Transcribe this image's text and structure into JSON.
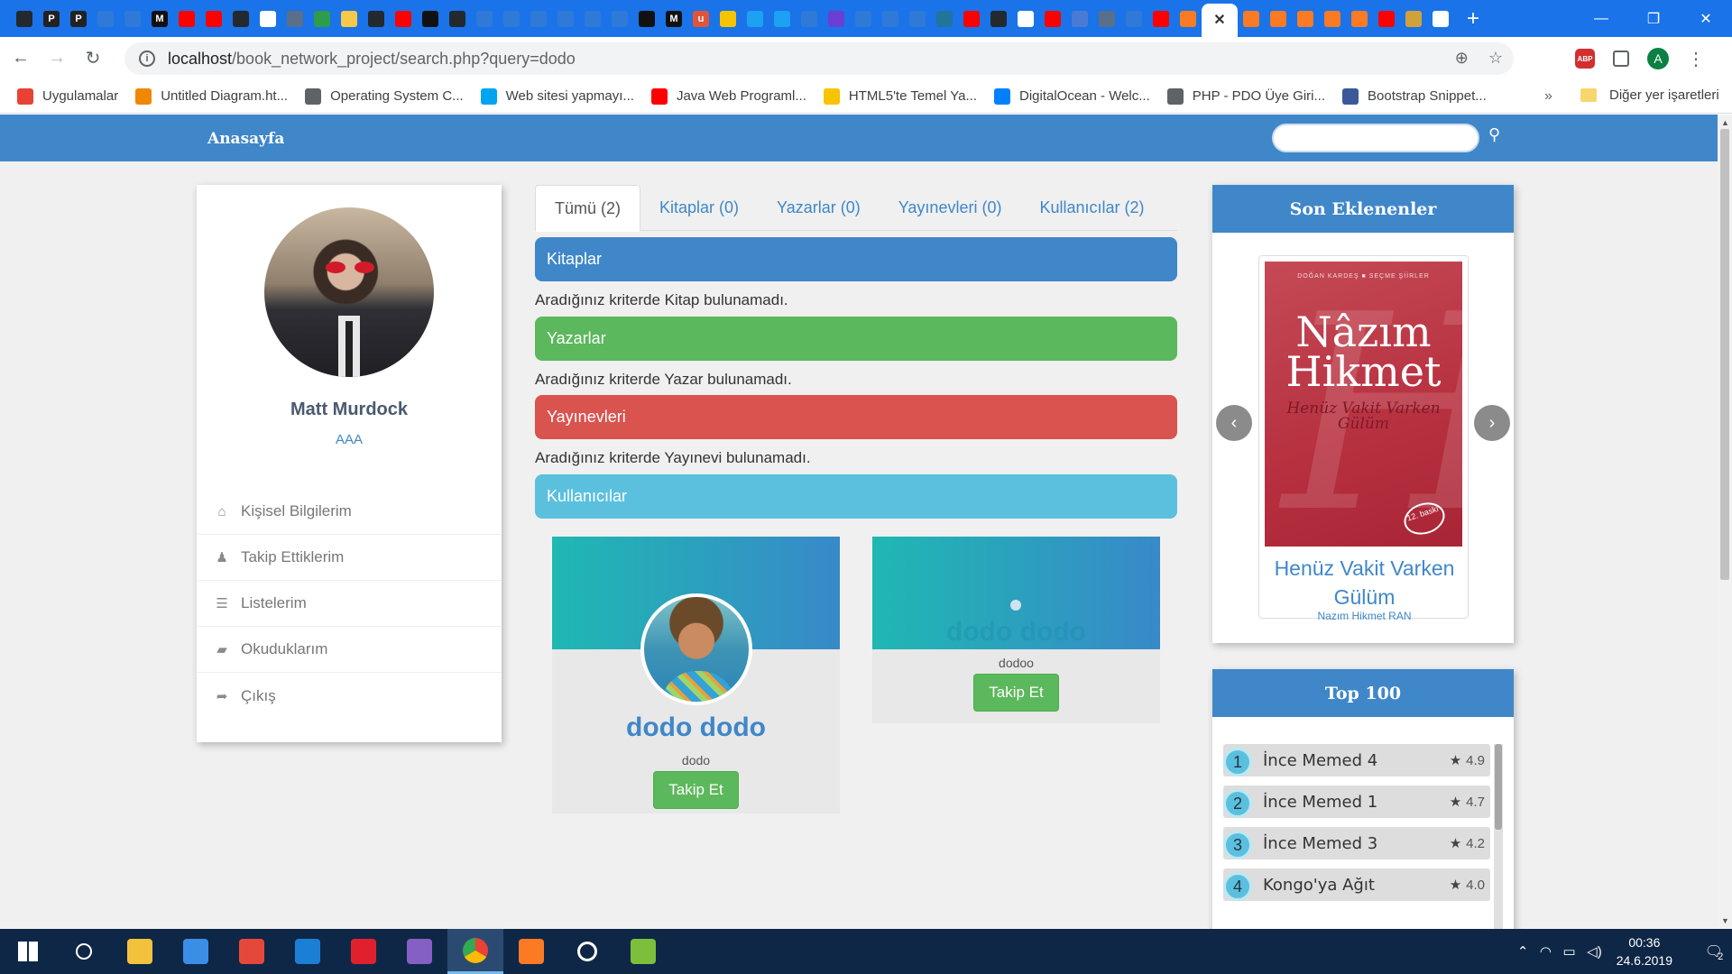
{
  "browser": {
    "tab_favicons": [
      {
        "name": "github",
        "glyph": "",
        "color": "#24292e"
      },
      {
        "name": "p-bookmark",
        "glyph": "P",
        "color": "#222222"
      },
      {
        "name": "p-bookmark-2",
        "glyph": "P",
        "color": "#222222"
      },
      {
        "name": "tab",
        "glyph": "",
        "color": "#2f7ad8"
      },
      {
        "name": "tab",
        "glyph": "",
        "color": "#2f7ad8"
      },
      {
        "name": "medium",
        "glyph": "M",
        "color": "#111111"
      },
      {
        "name": "youtube",
        "glyph": "",
        "color": "#ff0000"
      },
      {
        "name": "youtube",
        "glyph": "",
        "color": "#ff0000"
      },
      {
        "name": "github",
        "glyph": "",
        "color": "#24292e"
      },
      {
        "name": "tab",
        "glyph": "",
        "color": "#ffffff"
      },
      {
        "name": "tab",
        "glyph": "",
        "color": "#5a6f8a"
      },
      {
        "name": "tab",
        "glyph": "",
        "color": "#2e9c4a"
      },
      {
        "name": "python",
        "glyph": "",
        "color": "#f7c948"
      },
      {
        "name": "github",
        "glyph": "",
        "color": "#24292e"
      },
      {
        "name": "youtube",
        "glyph": "",
        "color": "#ff0000"
      },
      {
        "name": "tab",
        "glyph": "",
        "color": "#111111"
      },
      {
        "name": "github",
        "glyph": "",
        "color": "#24292e"
      },
      {
        "name": "tab",
        "glyph": "",
        "color": "#2f7ad8"
      },
      {
        "name": "tab",
        "glyph": "",
        "color": "#2f7ad8"
      },
      {
        "name": "tab",
        "glyph": "",
        "color": "#2f7ad8"
      },
      {
        "name": "tab",
        "glyph": "",
        "color": "#2f7ad8"
      },
      {
        "name": "tab",
        "glyph": "",
        "color": "#2f7ad8"
      },
      {
        "name": "tab",
        "glyph": "",
        "color": "#2f7ad8"
      },
      {
        "name": "tab",
        "glyph": "",
        "color": "#111111"
      },
      {
        "name": "medium",
        "glyph": "M",
        "color": "#111111"
      },
      {
        "name": "tab",
        "glyph": "u",
        "color": "#e0553a"
      },
      {
        "name": "tab",
        "glyph": "",
        "color": "#f6c400"
      },
      {
        "name": "twitter",
        "glyph": "",
        "color": "#1da1f2"
      },
      {
        "name": "twitter",
        "glyph": "",
        "color": "#1da1f2"
      },
      {
        "name": "tab",
        "glyph": "",
        "color": "#2f7ad8"
      },
      {
        "name": "tab",
        "glyph": "",
        "color": "#6b3fd6"
      },
      {
        "name": "tab",
        "glyph": "",
        "color": "#2f7ad8"
      },
      {
        "name": "tab",
        "glyph": "",
        "color": "#2f7ad8"
      },
      {
        "name": "tab",
        "glyph": "",
        "color": "#2f7ad8"
      },
      {
        "name": "wordpress",
        "glyph": "",
        "color": "#21759b"
      },
      {
        "name": "youtube",
        "glyph": "",
        "color": "#ff0000"
      },
      {
        "name": "github",
        "glyph": "",
        "color": "#24292e"
      },
      {
        "name": "google",
        "glyph": "",
        "color": "#ffffff"
      },
      {
        "name": "youtube",
        "glyph": "",
        "color": "#ff0000"
      },
      {
        "name": "tab",
        "glyph": "",
        "color": "#4a7bd4"
      },
      {
        "name": "tab",
        "glyph": "",
        "color": "#5a6f8a"
      },
      {
        "name": "tab",
        "glyph": "",
        "color": "#2f7ad8"
      },
      {
        "name": "youtube",
        "glyph": "",
        "color": "#ff0000"
      },
      {
        "name": "xampp",
        "glyph": "",
        "color": "#fb7a24"
      }
    ],
    "active_tab_glyph": "✕",
    "tab_favicons_after": [
      {
        "name": "xampp",
        "glyph": "",
        "color": "#fb7a24"
      },
      {
        "name": "xampp",
        "glyph": "",
        "color": "#fb7a24"
      },
      {
        "name": "xampp",
        "glyph": "",
        "color": "#fb7a24"
      },
      {
        "name": "xampp",
        "glyph": "",
        "color": "#fb7a24"
      },
      {
        "name": "xampp",
        "glyph": "",
        "color": "#fb7a24"
      },
      {
        "name": "youtube",
        "glyph": "",
        "color": "#ff0000"
      },
      {
        "name": "tab",
        "glyph": "",
        "color": "#d1a23a"
      },
      {
        "name": "tab",
        "glyph": "",
        "color": "#ffffff"
      }
    ],
    "new_tab_glyph": "+",
    "window_controls": [
      "—",
      "❐",
      "✕"
    ],
    "url_host": "localhost",
    "url_path": "/book_network_project/search.php?query=dodo",
    "bookmarks": [
      {
        "label": "Uygulamalar",
        "color": "#e94235"
      },
      {
        "label": "Untitled Diagram.ht...",
        "color": "#f08705"
      },
      {
        "label": "Operating System C...",
        "color": "#5f6368"
      },
      {
        "label": "Web sitesi yapmayı...",
        "color": "#00a4ef"
      },
      {
        "label": "Java Web Programl...",
        "color": "#ff0000"
      },
      {
        "label": "HTML5'te Temel Ya...",
        "color": "#f6c400"
      },
      {
        "label": "DigitalOcean - Welc...",
        "color": "#0080ff"
      },
      {
        "label": "PHP - PDO Üye Giri...",
        "color": "#5f6368"
      },
      {
        "label": "Bootstrap Snippet...",
        "color": "#3b5998"
      }
    ],
    "bookmarks_more": "»",
    "other_bookmarks": "Diğer yer işaretleri",
    "profile_initial": "A",
    "abp_label": "ABP"
  },
  "site": {
    "brand": "Anasayfa",
    "search": {
      "value": "",
      "placeholder": ""
    },
    "search_icon": "⚲"
  },
  "profile": {
    "name": "Matt Murdock",
    "handle": "AAA",
    "menu": [
      {
        "icon": "home-icon",
        "glyph": "⌂",
        "label": "Kişisel Bilgilerim"
      },
      {
        "icon": "user-icon",
        "glyph": "♟",
        "label": "Takip Ettiklerim"
      },
      {
        "icon": "list-icon",
        "glyph": "☰",
        "label": "Listelerim"
      },
      {
        "icon": "book-icon",
        "glyph": "▰",
        "label": "Okuduklarım"
      },
      {
        "icon": "sign-out-icon",
        "glyph": "➦",
        "label": "Çıkış"
      }
    ]
  },
  "results": {
    "tabs": [
      "Tümü (2)",
      "Kitaplar (0)",
      "Yazarlar (0)",
      "Yayınevleri (0)",
      "Kullanıcılar (2)"
    ],
    "sections": {
      "books": {
        "title": "Kitaplar",
        "message": "Aradığınız kriterde Kitap bulunamadı."
      },
      "authors": {
        "title": "Yazarlar",
        "message": "Aradığınız kriterde Yazar bulunamadı."
      },
      "publishers": {
        "title": "Yayınevleri",
        "message": "Aradığınız kriterde Yayınevi bulunamadı."
      },
      "users": {
        "title": "Kullanıcılar"
      }
    },
    "users": [
      {
        "name": "dodo dodo",
        "handle": "dodo",
        "button": "Takip Et"
      },
      {
        "name": "dodo dodo",
        "handle": "dodoo",
        "button": "Takip Et"
      }
    ]
  },
  "recent": {
    "title": "Son Eklenenler",
    "book": {
      "cover_publisher": "DOĞAN KARDEŞ ■ SEÇME ŞİİRLER",
      "cover_title": "Nâzım Hikmet",
      "cover_subtitle": "Henüz Vakit Varken Gülüm",
      "cover_badge": "12. baskı",
      "title": "Henüz Vakit Varken Gülüm",
      "author": "Nazım Hikmet RAN"
    },
    "prev": "‹",
    "next": "›"
  },
  "top100": {
    "title": "Top 100",
    "items": [
      {
        "rank": "1",
        "title": "İnce Memed 4",
        "rating": "4.9"
      },
      {
        "rank": "2",
        "title": "İnce Memed 1",
        "rating": "4.7"
      },
      {
        "rank": "3",
        "title": "İnce Memed 3",
        "rating": "4.2"
      },
      {
        "rank": "4",
        "title": "Kongo'ya Ağıt",
        "rating": "4.0"
      }
    ]
  },
  "taskbar": {
    "apps": [
      {
        "name": "start",
        "color": "#ffffff"
      },
      {
        "name": "search",
        "color": "#ffffff"
      },
      {
        "name": "file-explorer",
        "color": "#f3c23d"
      },
      {
        "name": "store",
        "color": "#3a8ee6"
      },
      {
        "name": "app",
        "color": "#e5483b"
      },
      {
        "name": "edge",
        "color": "#1c7fd6"
      },
      {
        "name": "opera",
        "color": "#e0212d"
      },
      {
        "name": "visual-studio",
        "color": "#865fc5"
      },
      {
        "name": "chrome",
        "color": "#4caf50"
      },
      {
        "name": "xampp",
        "color": "#fb7a24"
      },
      {
        "name": "settings",
        "color": "#ffffff"
      },
      {
        "name": "app",
        "color": "#7cbf3a"
      }
    ],
    "time": "00:36",
    "date": "24.6.2019",
    "notifications": "2"
  },
  "colors": {
    "primary": "#3f87c9",
    "success": "#5cb85c",
    "danger": "#d9534f",
    "info": "#5bc0de"
  }
}
